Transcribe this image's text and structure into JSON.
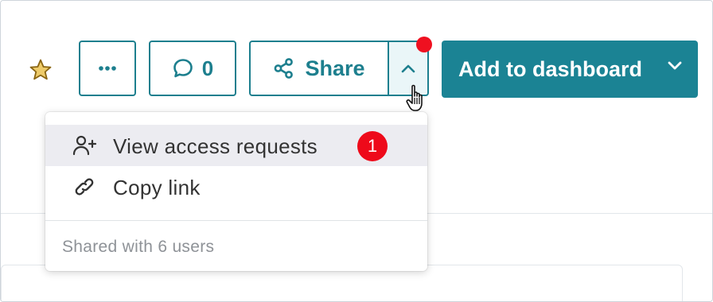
{
  "toolbar": {
    "favorite_icon": "star-icon",
    "more_icon": "ellipsis-icon",
    "comments": {
      "icon": "comment-icon",
      "count": "0"
    },
    "share": {
      "icon": "share-icon",
      "label": "Share"
    },
    "share_menu_toggle_icon": "chevron-up-icon",
    "add_to_dashboard": {
      "label": "Add to dashboard",
      "icon": "chevron-down-icon"
    }
  },
  "share_menu": {
    "items": [
      {
        "label": "View access requests",
        "icon": "user-plus-icon",
        "badge": "1"
      },
      {
        "label": "Copy link",
        "icon": "link-icon"
      }
    ],
    "footer": "Shared with 6 users"
  },
  "colors": {
    "accent": "#1b8394",
    "border": "#1d7f8e",
    "badge": "#ee0a1a",
    "star": "#d7a734",
    "hover_bg": "#ececf1"
  }
}
